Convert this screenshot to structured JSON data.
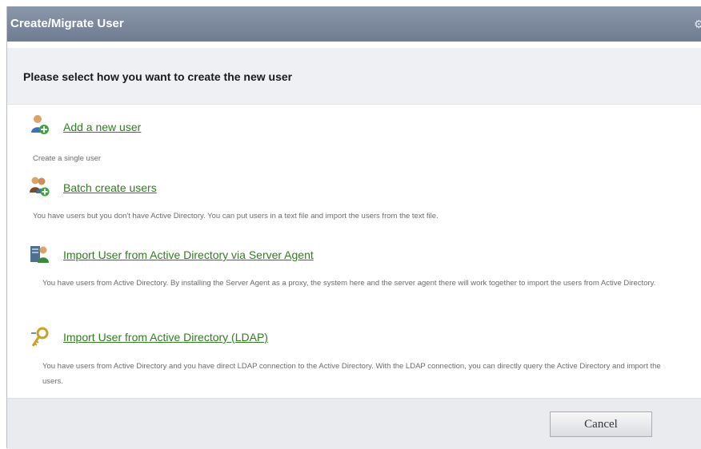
{
  "dialog": {
    "title": "Create/Migrate User",
    "subtitle": "Please select how you want to create the new user",
    "cancel_label": "Cancel"
  },
  "options": [
    {
      "icon": "user-add-icon",
      "label": "Add a new user",
      "description": "Create a single user"
    },
    {
      "icon": "users-group-icon",
      "label": "Batch create users",
      "description": "You have users but you don't have Active Directory. You can put users in a text file and import the users from the text file."
    },
    {
      "icon": "server-agent-icon",
      "label": "Import User from Active Directory via Server Agent",
      "description": "You have users from Active Directory. By installing the Server Agent as a proxy, the system here and the server agent there will work together to import the users from Active Directory."
    },
    {
      "icon": "ldap-icon",
      "label": "Import User from Active Directory (LDAP)",
      "description": "You have users from Active Directory and you have direct LDAP connection to the Active Directory. With the LDAP connection, you can directly query the Active Directory and import the users."
    }
  ]
}
